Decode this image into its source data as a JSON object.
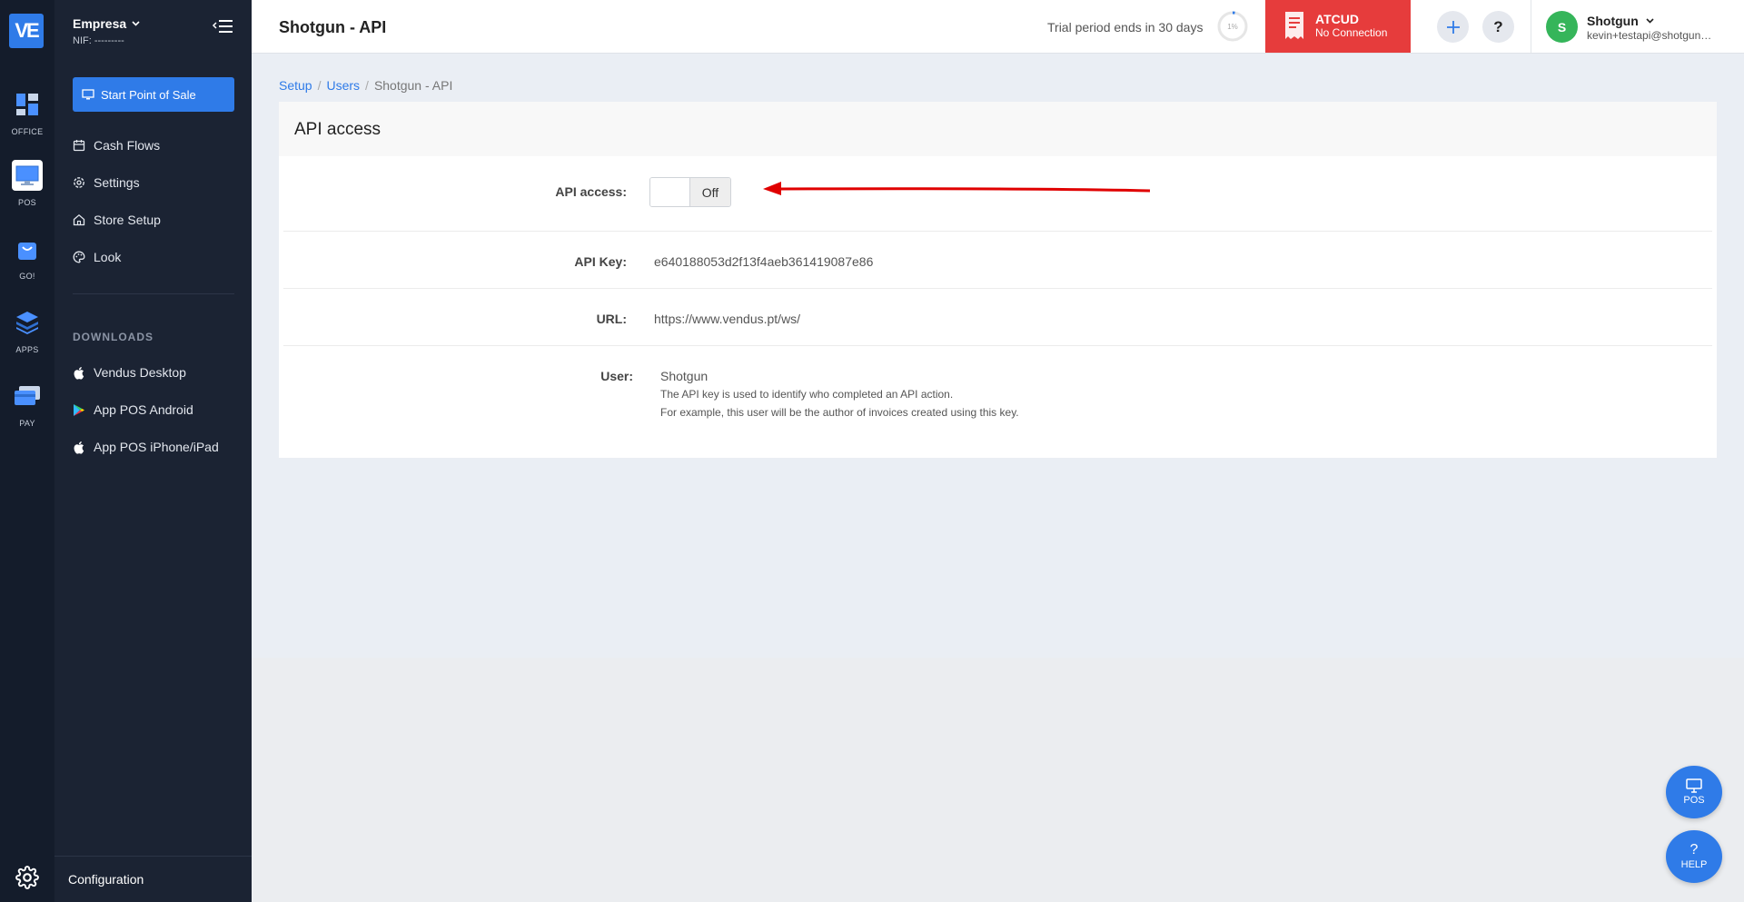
{
  "rail": {
    "logo": "VE",
    "items": [
      {
        "label": "OFFICE"
      },
      {
        "label": "POS"
      },
      {
        "label": "GO!"
      },
      {
        "label": "APPS"
      },
      {
        "label": "PAY"
      }
    ]
  },
  "sidebar": {
    "company_name": "Empresa",
    "nif": "NIF: ---------",
    "start_pos_label": "Start Point of Sale",
    "nav": [
      {
        "label": "Cash Flows"
      },
      {
        "label": "Settings"
      },
      {
        "label": "Store Setup"
      },
      {
        "label": "Look"
      }
    ],
    "downloads_label": "DOWNLOADS",
    "downloads": [
      {
        "label": "Vendus Desktop"
      },
      {
        "label": "App POS Android"
      },
      {
        "label": "App POS iPhone/iPad"
      }
    ],
    "config_label": "Configuration"
  },
  "header": {
    "title": "Shotgun - API",
    "trial_text": "Trial period ends in 30 days",
    "trial_progress_label": "1%",
    "trial_progress": 0.01,
    "atcud_title": "ATCUD",
    "atcud_status": "No Connection",
    "user_initial": "S",
    "user_name": "Shotgun",
    "user_email": "kevin+testapi@shotgun.live"
  },
  "breadcrumb": {
    "items": [
      "Setup",
      "Users"
    ],
    "current": "Shotgun - API"
  },
  "card": {
    "title": "API access",
    "api_access_label": "API access:",
    "api_access_state": "Off",
    "api_key_label": "API Key:",
    "api_key": "e640188053d2f13f4aeb361419087e86",
    "url_label": "URL:",
    "url": "https://www.vendus.pt/ws/",
    "user_label": "User:",
    "user_value": "Shotgun",
    "user_help_1": "The API key is used to identify who completed an API action.",
    "user_help_2": "For example, this user will be the author of invoices created using this key."
  },
  "fab": {
    "pos_label": "POS",
    "help_label": "HELP"
  },
  "colors": {
    "accent": "#2f7be8",
    "danger": "#e63c3c",
    "annotation_arrow": "#e00000",
    "avatar": "#35b55a"
  }
}
